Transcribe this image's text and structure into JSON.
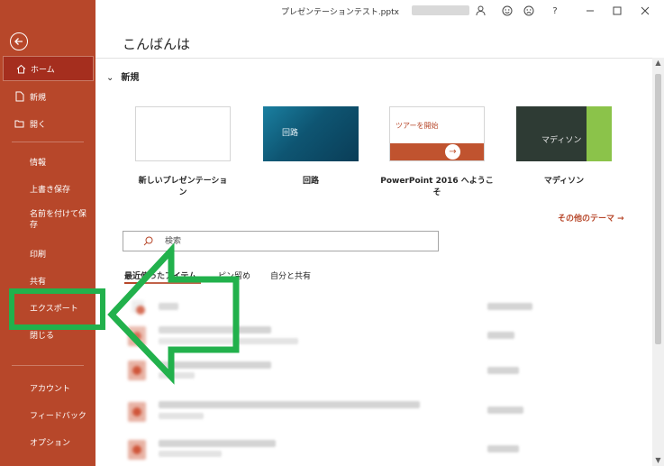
{
  "window": {
    "title": "プレゼンテーションテスト.pptx"
  },
  "sidebar": {
    "items": [
      {
        "label": "ホーム",
        "icon": "home-icon"
      },
      {
        "label": "新規",
        "icon": "new-file-icon"
      },
      {
        "label": "開く",
        "icon": "open-folder-icon"
      },
      {
        "label": "情報"
      },
      {
        "label": "上書き保存"
      },
      {
        "label": "名前を付けて保存"
      },
      {
        "label": "印刷"
      },
      {
        "label": "共有"
      },
      {
        "label": "エクスポート"
      },
      {
        "label": "閉じる"
      },
      {
        "label": "アカウント"
      },
      {
        "label": "フィードバック"
      },
      {
        "label": "オプション"
      }
    ]
  },
  "main": {
    "greeting": "こんばんは",
    "new_section": "新規",
    "templates": [
      {
        "label": "新しいプレゼンテーション"
      },
      {
        "label": "回路",
        "thumb_text": "回路"
      },
      {
        "label": "PowerPoint 2016 へようこそ",
        "thumb_text": "ツアーを開始"
      },
      {
        "label": "マディソン",
        "thumb_text": "マディソン"
      }
    ],
    "more_themes": "その他のテーマ →",
    "search_placeholder": "検索",
    "tabs": [
      "最近使ったアイテム",
      "ピン留め",
      "自分と共有"
    ]
  },
  "colors": {
    "accent": "#b7472a",
    "annotation": "#22b14c"
  }
}
